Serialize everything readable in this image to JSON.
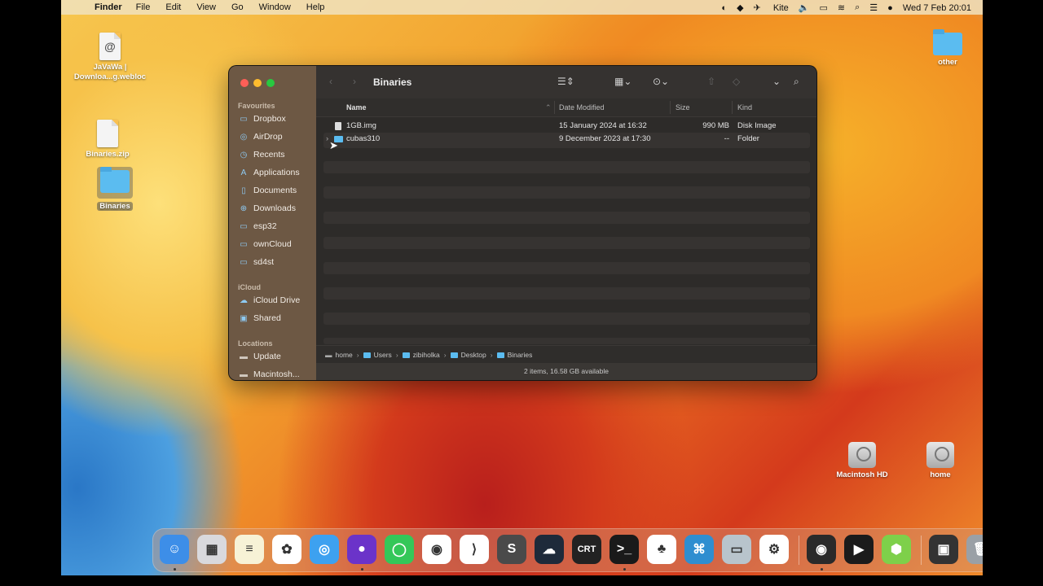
{
  "menubar": {
    "apple": "",
    "app_name": "Finder",
    "menus": [
      "File",
      "Edit",
      "View",
      "Go",
      "Window",
      "Help"
    ],
    "status": {
      "kite": "Kite",
      "datetime": "Wed 7 Feb  20:01"
    }
  },
  "desktop": {
    "icons": [
      {
        "label": "JaVaWa | Downloa...g.webloc",
        "kind": "webloc"
      },
      {
        "label": "Binaries.zip",
        "kind": "zip"
      },
      {
        "label": "Binaries",
        "kind": "folder",
        "selected": true
      },
      {
        "label": "other",
        "kind": "folder"
      },
      {
        "label": "Macintosh HD",
        "kind": "disk"
      },
      {
        "label": "home",
        "kind": "disk"
      }
    ],
    "webloc_badge": "@"
  },
  "finder": {
    "title": "Binaries",
    "sidebar": {
      "favourites_heading": "Favourites",
      "favourites": [
        {
          "label": "Dropbox",
          "icon": "folder-icon"
        },
        {
          "label": "AirDrop",
          "icon": "airdrop-icon"
        },
        {
          "label": "Recents",
          "icon": "clock-icon"
        },
        {
          "label": "Applications",
          "icon": "applications-icon"
        },
        {
          "label": "Documents",
          "icon": "document-icon"
        },
        {
          "label": "Downloads",
          "icon": "download-icon"
        },
        {
          "label": "esp32",
          "icon": "folder-icon"
        },
        {
          "label": "ownCloud",
          "icon": "folder-icon"
        },
        {
          "label": "sd4st",
          "icon": "folder-icon"
        }
      ],
      "icloud_heading": "iCloud",
      "icloud": [
        {
          "label": "iCloud Drive",
          "icon": "cloud-icon"
        },
        {
          "label": "Shared",
          "icon": "shared-folder-icon"
        }
      ],
      "locations_heading": "Locations",
      "locations": [
        {
          "label": "Update",
          "icon": "disk-icon"
        },
        {
          "label": "Macintosh...",
          "icon": "disk-icon"
        }
      ]
    },
    "columns": {
      "name": "Name",
      "date_modified": "Date Modified",
      "size": "Size",
      "kind": "Kind"
    },
    "files": [
      {
        "name": "1GB.img",
        "date": "15 January 2024 at 16:32",
        "size": "990 MB",
        "kind": "Disk Image",
        "type": "file"
      },
      {
        "name": "cubas310",
        "date": "9 December 2023 at 17:30",
        "size": "--",
        "kind": "Folder",
        "type": "folder"
      }
    ],
    "path": [
      "home",
      "Users",
      "zibiholka",
      "Desktop",
      "Binaries"
    ],
    "status": "2 items, 16.58 GB available"
  },
  "dock": {
    "apps": [
      {
        "name": "Finder",
        "color": "#3d8ee8",
        "glyph": "☺",
        "running": true
      },
      {
        "name": "Launchpad",
        "color": "#d9d9dd",
        "glyph": "▦",
        "running": false
      },
      {
        "name": "Notes",
        "color": "#f7f2d6",
        "glyph": "≡",
        "running": false
      },
      {
        "name": "Photos",
        "color": "#ffffff",
        "glyph": "✿",
        "running": false
      },
      {
        "name": "Safari",
        "color": "#3da1f0",
        "glyph": "◎",
        "running": false
      },
      {
        "name": "Firefox",
        "color": "#6b33c9",
        "glyph": "●",
        "running": true
      },
      {
        "name": "Messages",
        "color": "#34c759",
        "glyph": "◯",
        "running": false
      },
      {
        "name": "Chrome",
        "color": "#ffffff",
        "glyph": "◉",
        "running": false
      },
      {
        "name": "VS Code",
        "color": "#ffffff",
        "glyph": "⟩",
        "running": false
      },
      {
        "name": "Sublime Text",
        "color": "#4a4a4a",
        "glyph": "S",
        "running": false
      },
      {
        "name": "ChatGPT",
        "color": "#1e2a3a",
        "glyph": "☁",
        "running": false
      },
      {
        "name": "CRT",
        "color": "#222222",
        "glyph": "CRT",
        "running": false
      },
      {
        "name": "Terminal",
        "color": "#1a1a1a",
        "glyph": ">_",
        "running": true
      },
      {
        "name": "Evernote",
        "color": "#ffffff",
        "glyph": "♣",
        "running": false
      },
      {
        "name": "Network Tool",
        "color": "#2f8ed0",
        "glyph": "⌘",
        "running": false
      },
      {
        "name": "USB Tool",
        "color": "#b8c4cc",
        "glyph": "▭",
        "running": false
      },
      {
        "name": "OBS Settings",
        "color": "#ffffff",
        "glyph": "⚙",
        "running": false
      },
      {
        "name": "OBS",
        "color": "#2a2a2a",
        "glyph": "◉",
        "running": true
      },
      {
        "name": "Prompt",
        "color": "#1b1b1b",
        "glyph": "▶",
        "running": false
      },
      {
        "name": "Cube App",
        "color": "#7ed04a",
        "glyph": "⬢",
        "running": false
      },
      {
        "name": "Video Editor",
        "color": "#333333",
        "glyph": "▣",
        "running": false
      },
      {
        "name": "Trash",
        "color": "#9aa0a6",
        "glyph": "🗑",
        "running": false
      }
    ]
  }
}
